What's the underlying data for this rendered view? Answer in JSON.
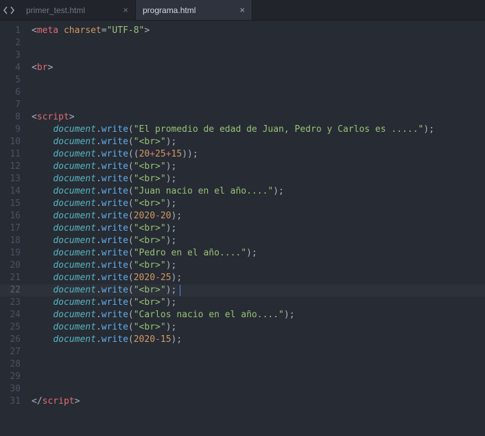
{
  "tabs": [
    {
      "label": "primer_test.html",
      "active": false
    },
    {
      "label": "programa.html",
      "active": true
    }
  ],
  "current_line": 22,
  "cursor_col_ch": 30,
  "code_lines": [
    {
      "n": 1,
      "tokens": [
        [
          "punc",
          "<"
        ],
        [
          "tag",
          "meta"
        ],
        [
          "plain",
          " "
        ],
        [
          "attr",
          "charset"
        ],
        [
          "op",
          "="
        ],
        [
          "str",
          "\"UTF-8\""
        ],
        [
          "punc",
          ">"
        ]
      ]
    },
    {
      "n": 2,
      "tokens": []
    },
    {
      "n": 3,
      "tokens": []
    },
    {
      "n": 4,
      "tokens": [
        [
          "punc",
          "<"
        ],
        [
          "tag",
          "br"
        ],
        [
          "punc",
          ">"
        ]
      ]
    },
    {
      "n": 5,
      "tokens": []
    },
    {
      "n": 6,
      "tokens": []
    },
    {
      "n": 7,
      "tokens": []
    },
    {
      "n": 8,
      "tokens": [
        [
          "punc",
          "<"
        ],
        [
          "tag",
          "script"
        ],
        [
          "punc",
          ">"
        ]
      ]
    },
    {
      "n": 9,
      "tokens": [
        [
          "plain",
          "    "
        ],
        [
          "obj",
          "document"
        ],
        [
          "punc",
          "."
        ],
        [
          "func",
          "write"
        ],
        [
          "punc",
          "("
        ],
        [
          "str",
          "\"El promedio de edad de Juan, Pedro y Carlos es .....\""
        ],
        [
          "punc",
          ");"
        ]
      ]
    },
    {
      "n": 10,
      "tokens": [
        [
          "plain",
          "    "
        ],
        [
          "obj",
          "document"
        ],
        [
          "punc",
          "."
        ],
        [
          "func",
          "write"
        ],
        [
          "punc",
          "("
        ],
        [
          "str",
          "\"<br>\""
        ],
        [
          "punc",
          ");"
        ]
      ]
    },
    {
      "n": 11,
      "tokens": [
        [
          "plain",
          "    "
        ],
        [
          "obj",
          "document"
        ],
        [
          "punc",
          "."
        ],
        [
          "func",
          "write"
        ],
        [
          "punc",
          "(("
        ],
        [
          "num",
          "20"
        ],
        [
          "red",
          "+"
        ],
        [
          "num",
          "25"
        ],
        [
          "red",
          "+"
        ],
        [
          "num",
          "15"
        ],
        [
          "punc",
          "));"
        ]
      ]
    },
    {
      "n": 12,
      "tokens": [
        [
          "plain",
          "    "
        ],
        [
          "obj",
          "document"
        ],
        [
          "punc",
          "."
        ],
        [
          "func",
          "write"
        ],
        [
          "punc",
          "("
        ],
        [
          "str",
          "\"<br>\""
        ],
        [
          "punc",
          ");"
        ]
      ]
    },
    {
      "n": 13,
      "tokens": [
        [
          "plain",
          "    "
        ],
        [
          "obj",
          "document"
        ],
        [
          "punc",
          "."
        ],
        [
          "func",
          "write"
        ],
        [
          "punc",
          "("
        ],
        [
          "str",
          "\"<br>\""
        ],
        [
          "punc",
          ");"
        ]
      ]
    },
    {
      "n": 14,
      "tokens": [
        [
          "plain",
          "    "
        ],
        [
          "obj",
          "document"
        ],
        [
          "punc",
          "."
        ],
        [
          "func",
          "write"
        ],
        [
          "punc",
          "("
        ],
        [
          "str",
          "\"Juan nacio en el año....\""
        ],
        [
          "punc",
          ");"
        ]
      ]
    },
    {
      "n": 15,
      "tokens": [
        [
          "plain",
          "    "
        ],
        [
          "obj",
          "document"
        ],
        [
          "punc",
          "."
        ],
        [
          "func",
          "write"
        ],
        [
          "punc",
          "("
        ],
        [
          "str",
          "\"<br>\""
        ],
        [
          "punc",
          ");"
        ]
      ]
    },
    {
      "n": 16,
      "tokens": [
        [
          "plain",
          "    "
        ],
        [
          "obj",
          "document"
        ],
        [
          "punc",
          "."
        ],
        [
          "func",
          "write"
        ],
        [
          "punc",
          "("
        ],
        [
          "num",
          "2020"
        ],
        [
          "red",
          "-"
        ],
        [
          "num",
          "20"
        ],
        [
          "punc",
          ");"
        ]
      ]
    },
    {
      "n": 17,
      "tokens": [
        [
          "plain",
          "    "
        ],
        [
          "obj",
          "document"
        ],
        [
          "punc",
          "."
        ],
        [
          "func",
          "write"
        ],
        [
          "punc",
          "("
        ],
        [
          "str",
          "\"<br>\""
        ],
        [
          "punc",
          ");"
        ]
      ]
    },
    {
      "n": 18,
      "tokens": [
        [
          "plain",
          "    "
        ],
        [
          "obj",
          "document"
        ],
        [
          "punc",
          "."
        ],
        [
          "func",
          "write"
        ],
        [
          "punc",
          "("
        ],
        [
          "str",
          "\"<br>\""
        ],
        [
          "punc",
          ");"
        ]
      ]
    },
    {
      "n": 19,
      "tokens": [
        [
          "plain",
          "    "
        ],
        [
          "obj",
          "document"
        ],
        [
          "punc",
          "."
        ],
        [
          "func",
          "write"
        ],
        [
          "punc",
          "("
        ],
        [
          "str",
          "\"Pedro en el año....\""
        ],
        [
          "punc",
          ");"
        ]
      ]
    },
    {
      "n": 20,
      "tokens": [
        [
          "plain",
          "    "
        ],
        [
          "obj",
          "document"
        ],
        [
          "punc",
          "."
        ],
        [
          "func",
          "write"
        ],
        [
          "punc",
          "("
        ],
        [
          "str",
          "\"<br>\""
        ],
        [
          "punc",
          ");"
        ]
      ]
    },
    {
      "n": 21,
      "tokens": [
        [
          "plain",
          "    "
        ],
        [
          "obj",
          "document"
        ],
        [
          "punc",
          "."
        ],
        [
          "func",
          "write"
        ],
        [
          "punc",
          "("
        ],
        [
          "num",
          "2020"
        ],
        [
          "red",
          "-"
        ],
        [
          "num",
          "25"
        ],
        [
          "punc",
          ");"
        ]
      ]
    },
    {
      "n": 22,
      "tokens": [
        [
          "plain",
          "    "
        ],
        [
          "obj",
          "document"
        ],
        [
          "punc",
          "."
        ],
        [
          "func",
          "write"
        ],
        [
          "punc",
          "("
        ],
        [
          "str",
          "\"<br>\""
        ],
        [
          "punc",
          ");"
        ]
      ]
    },
    {
      "n": 23,
      "tokens": [
        [
          "plain",
          "    "
        ],
        [
          "obj",
          "document"
        ],
        [
          "punc",
          "."
        ],
        [
          "func",
          "write"
        ],
        [
          "punc",
          "("
        ],
        [
          "str",
          "\"<br>\""
        ],
        [
          "punc",
          ");"
        ]
      ]
    },
    {
      "n": 24,
      "tokens": [
        [
          "plain",
          "    "
        ],
        [
          "obj",
          "document"
        ],
        [
          "punc",
          "."
        ],
        [
          "func",
          "write"
        ],
        [
          "punc",
          "("
        ],
        [
          "str",
          "\"Carlos nacio en el año....\""
        ],
        [
          "punc",
          ");"
        ]
      ]
    },
    {
      "n": 25,
      "tokens": [
        [
          "plain",
          "    "
        ],
        [
          "obj",
          "document"
        ],
        [
          "punc",
          "."
        ],
        [
          "func",
          "write"
        ],
        [
          "punc",
          "("
        ],
        [
          "str",
          "\"<br>\""
        ],
        [
          "punc",
          ");"
        ]
      ]
    },
    {
      "n": 26,
      "tokens": [
        [
          "plain",
          "    "
        ],
        [
          "obj",
          "document"
        ],
        [
          "punc",
          "."
        ],
        [
          "func",
          "write"
        ],
        [
          "punc",
          "("
        ],
        [
          "num",
          "2020"
        ],
        [
          "red",
          "-"
        ],
        [
          "num",
          "15"
        ],
        [
          "punc",
          ");"
        ]
      ]
    },
    {
      "n": 27,
      "tokens": []
    },
    {
      "n": 28,
      "tokens": []
    },
    {
      "n": 29,
      "tokens": []
    },
    {
      "n": 30,
      "tokens": []
    },
    {
      "n": 31,
      "tokens": [
        [
          "punc",
          "</"
        ],
        [
          "tag",
          "script"
        ],
        [
          "punc",
          ">"
        ]
      ]
    }
  ]
}
